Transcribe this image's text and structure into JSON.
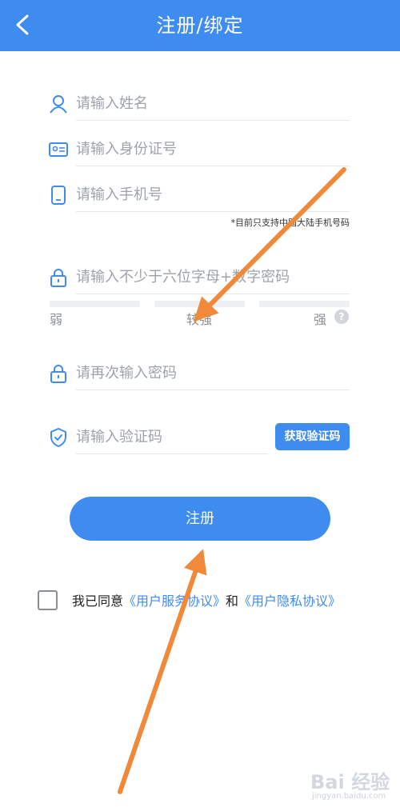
{
  "header": {
    "title": "注册/绑定"
  },
  "form": {
    "name_placeholder": "请输入姓名",
    "id_placeholder": "请输入身份证号",
    "phone_placeholder": "请输入手机号",
    "phone_note": "*目前只支持中国大陆手机号码",
    "password_placeholder": "请输入不少于六位字母+数字密码",
    "strength": {
      "weak": "弱",
      "medium": "较强",
      "strong": "强"
    },
    "confirm_placeholder": "请再次输入密码",
    "code_placeholder": "请输入验证码",
    "get_code_label": "获取验证码",
    "register_label": "注册"
  },
  "agreement": {
    "prefix": "我已同意",
    "service_link": "《用户服务协议》",
    "and": "和",
    "privacy_link": "《用户隐私协议》",
    "checked": false
  },
  "watermark": {
    "brand": "Bai 经验",
    "url": "jingyan.baidu.com"
  },
  "colors": {
    "primary": "#3f8cf0",
    "arrow": "#f08a3a"
  }
}
